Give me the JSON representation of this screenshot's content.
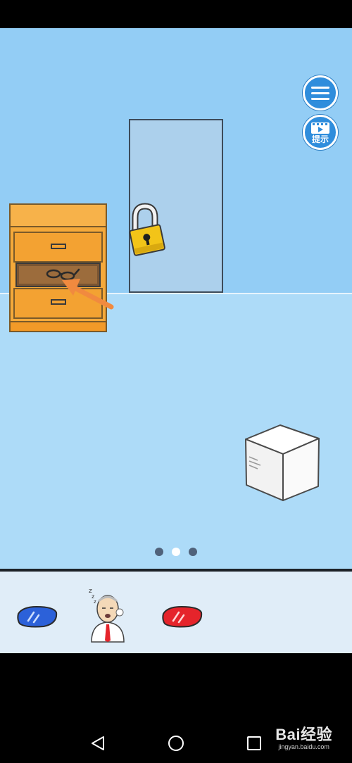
{
  "hud": {
    "menu_icon": "hamburger-menu-icon",
    "hint_icon": "video-play-icon",
    "hint_label": "提示"
  },
  "scene": {
    "page_indicator": {
      "count": 3,
      "active_index": 1
    },
    "objects": [
      "dresser",
      "drawer-with-glasses",
      "pointer-arrow",
      "locked-door",
      "padlock",
      "white-box"
    ]
  },
  "inventory": {
    "items": [
      "blue-lens",
      "sleeping-old-man",
      "red-lens"
    ]
  },
  "navigation": {
    "buttons": [
      "back",
      "home",
      "recents"
    ]
  },
  "watermark": {
    "brand": "Bai经验",
    "url": "jingyan.baidu.com"
  },
  "colors": {
    "wall": "#93cdf5",
    "floor": "#addbf8",
    "door": "#acd0ec",
    "dresser": "#f5a93a",
    "padlock": "#f2c418",
    "arrow": "#f18a3f",
    "button": "#2f8ddc",
    "blue_lens": "#2c61d9",
    "red_lens": "#e5242b"
  }
}
